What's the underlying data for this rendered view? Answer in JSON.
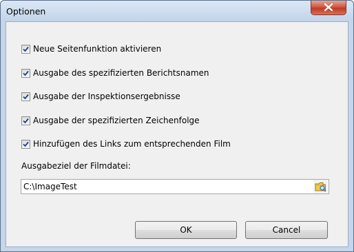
{
  "window": {
    "title": "Optionen",
    "close_icon": "close-icon"
  },
  "options": [
    {
      "label": "Neue Seitenfunktion aktivieren",
      "checked": true
    },
    {
      "label": "Ausgabe des spezifizierten Berichtsnamen",
      "checked": true
    },
    {
      "label": "Ausgabe der Inspektionsergebnisse",
      "checked": true
    },
    {
      "label": "Ausgabe der spezifizierten Zeichenfolge",
      "checked": true
    },
    {
      "label": "Hinzufügen des Links zum entsprechenden Film",
      "checked": true
    }
  ],
  "output": {
    "label": "Ausgabeziel der Filmdatei:",
    "path": "C:\\ImageTest",
    "browse_icon": "folder-browse-icon"
  },
  "buttons": {
    "ok": "OK",
    "cancel": "Cancel"
  },
  "colors": {
    "frame": "#c5d6ea",
    "client": "#f0f0f0",
    "close": "#c13a24",
    "check": "#1f3f8f"
  }
}
